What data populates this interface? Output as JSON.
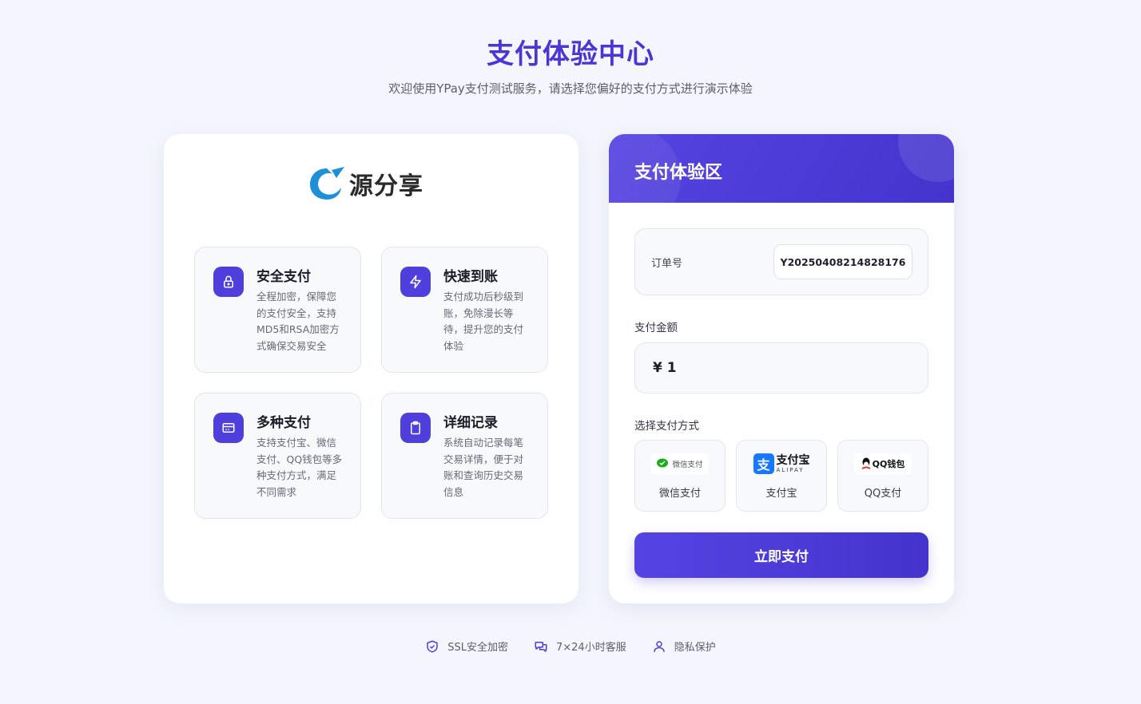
{
  "header": {
    "title": "支付体验中心",
    "subtitle": "欢迎使用YPay支付测试服务，请选择您偏好的支付方式进行演示体验"
  },
  "brand": {
    "logo_text": "源分享",
    "accent": "#4f3fdc"
  },
  "features": [
    {
      "title": "安全支付",
      "desc": "全程加密，保障您的支付安全，支持MD5和RSA加密方式确保交易安全",
      "icon": "lock-icon"
    },
    {
      "title": "快速到账",
      "desc": "支付成功后秒级到账，免除漫长等待，提升您的支付体验",
      "icon": "lightning-icon"
    },
    {
      "title": "多种支付",
      "desc": "支持支付宝、微信支付、QQ钱包等多种支付方式，满足不同需求",
      "icon": "card-icon"
    },
    {
      "title": "详细记录",
      "desc": "系统自动记录每笔交易详情，便于对账和查询历史交易信息",
      "icon": "clipboard-icon"
    }
  ],
  "payment": {
    "title": "支付体验区",
    "order_label": "订单号",
    "order_value": "Y20250408214828176",
    "amount_label": "支付金额",
    "amount_value": "¥ 1",
    "method_label": "选择支付方式",
    "methods": [
      {
        "name": "微信支付",
        "logo_text": "微信支付",
        "color": "#1aad19"
      },
      {
        "name": "支付宝",
        "logo_text": "支付宝",
        "logo_sub": "ALIPAY",
        "color": "#1677ff"
      },
      {
        "name": "QQ支付",
        "logo_text": "QQ钱包",
        "color": "#111111"
      }
    ],
    "submit_label": "立即支付"
  },
  "footer": [
    {
      "label": "SSL安全加密",
      "icon": "shield-check-icon"
    },
    {
      "label": "7×24小时客服",
      "icon": "chat-icon"
    },
    {
      "label": "隐私保护",
      "icon": "user-icon"
    }
  ]
}
